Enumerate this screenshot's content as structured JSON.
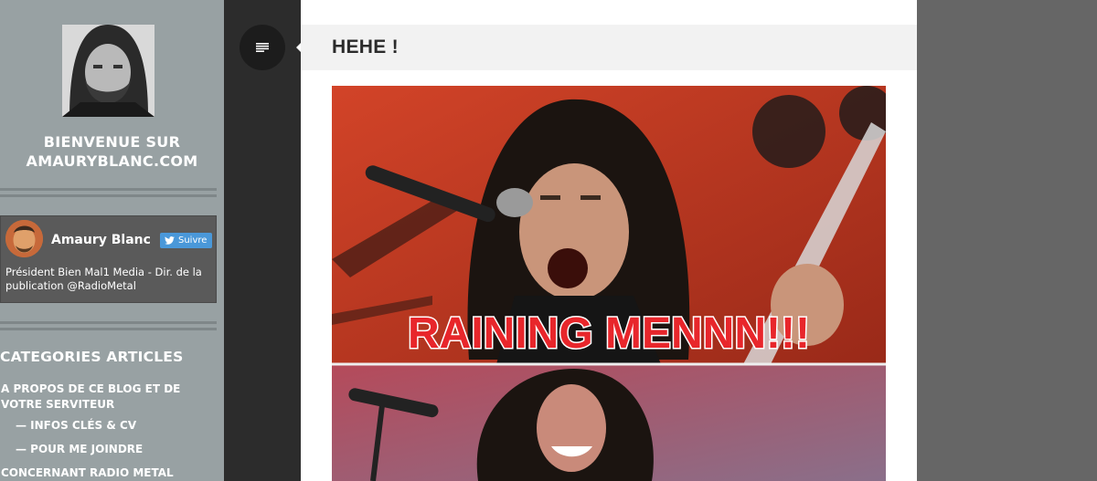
{
  "sidebar": {
    "site_title": "BIENVENUE SUR AMAURYBLANC.COM",
    "twitter_card": {
      "name": "Amaury Blanc",
      "follow_label": "Suivre",
      "bio": "Président Bien Mal1 Media - Dir. de la publication @RadioMetal"
    },
    "categories": {
      "heading": "CATEGORIES ARTICLES",
      "items": [
        {
          "label": "A PROPOS DE CE BLOG ET DE VOTRE SERVITEUR"
        },
        {
          "label": "— INFOS CLÉS & CV"
        },
        {
          "label": "— POUR ME JOINDRE"
        },
        {
          "label": "CONCERNANT RADIO METAL"
        }
      ]
    }
  },
  "rail": {
    "menu_icon": "menu-lines-icon"
  },
  "post": {
    "title": "HEHE !",
    "image": {
      "caption": "RAINING MENNN!!!"
    }
  },
  "colors": {
    "sidebar_bg": "#98a1a3",
    "rail_bg": "#2c2c2c",
    "twitter_blue": "#4a98d9",
    "page_bg": "#666666"
  }
}
